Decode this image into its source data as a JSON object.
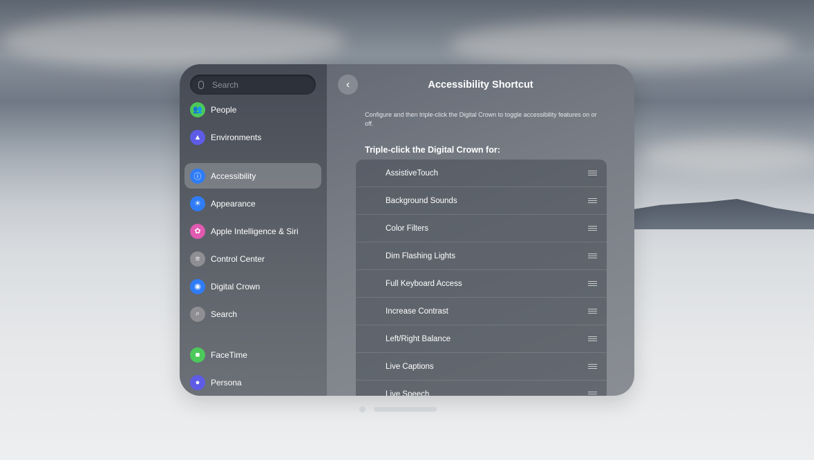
{
  "sidebar": {
    "search_placeholder": "Search",
    "items": [
      {
        "label": "People",
        "color": "#4cc95a",
        "icon": "people-icon"
      },
      {
        "label": "Environments",
        "color": "#5e5ce6",
        "icon": "mountain-icon"
      },
      {
        "label": "Accessibility",
        "color": "#2f7cf6",
        "icon": "accessibility-icon",
        "selected": true
      },
      {
        "label": "Appearance",
        "color": "#2f7cf6",
        "icon": "sun-icon"
      },
      {
        "label": "Apple Intelligence & Siri",
        "color": "#e05ab0",
        "icon": "siri-icon"
      },
      {
        "label": "Control Center",
        "color": "#8e8e93",
        "icon": "toggles-icon"
      },
      {
        "label": "Digital Crown",
        "color": "#2f7cf6",
        "icon": "crown-icon"
      },
      {
        "label": "Search",
        "color": "#8e8e93",
        "icon": "magnifier-icon"
      },
      {
        "label": "FaceTime",
        "color": "#4cc95a",
        "icon": "video-icon"
      },
      {
        "label": "Persona",
        "color": "#5e5ce6",
        "icon": "persona-icon"
      }
    ]
  },
  "main": {
    "title": "Accessibility Shortcut",
    "description": "Configure and then triple-click the Digital Crown to toggle accessibility features on or off.",
    "section_header": "Triple-click the Digital Crown for:",
    "rows": [
      "AssistiveTouch",
      "Background Sounds",
      "Color Filters",
      "Dim Flashing Lights",
      "Full Keyboard Access",
      "Increase Contrast",
      "Left/Right Balance",
      "Live Captions",
      "Live Speech"
    ]
  }
}
